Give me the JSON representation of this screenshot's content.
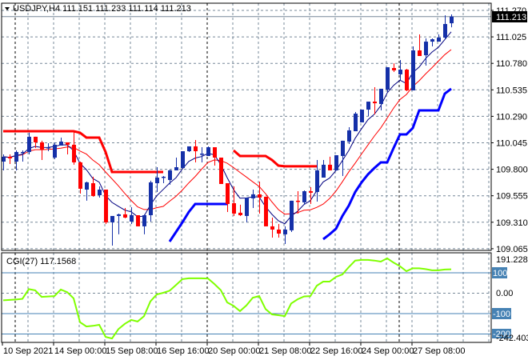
{
  "header": {
    "symbol": "USDJPY,H4",
    "ohlc": "111.151 111.233 111.114 111.213"
  },
  "colors": {
    "bull": "#1530a8",
    "bear": "#ff0000",
    "fast_ma": "#000080",
    "slow_ma": "#ff0000",
    "upper_band": "#ff0000",
    "lower_band": "#0000ff",
    "cci": "#7fff00",
    "level_line": "#4682b4",
    "grid": "#778899"
  },
  "price_axis": {
    "labels": [
      "111.270",
      "111.025",
      "110.780",
      "110.535",
      "110.290",
      "110.045",
      "109.800",
      "109.555",
      "109.310",
      "109.065"
    ],
    "current_price": "111.213"
  },
  "cci_panel": {
    "label": "CGI(27) 117.1568",
    "max_label": "191.2285",
    "min_label": "-242.4031",
    "zero_label": "0.00",
    "levels": [
      "100",
      "-100",
      "-200"
    ]
  },
  "time_axis": {
    "labels": [
      "10 Sep 2021",
      "14 Sep 00:00",
      "15 Sep 08:00",
      "16 Sep 16:00",
      "20 Sep 00:00",
      "21 Sep 08:00",
      "22 Sep 16:00",
      "24 Sep 00:00",
      "27 Sep 08:00"
    ]
  },
  "chart_data": {
    "type": "candlestick",
    "symbol": "USDJPY",
    "timeframe": "H4",
    "ylim": [
      109.065,
      111.27
    ],
    "candles": [
      [
        109.871,
        109.938,
        109.79,
        109.916
      ],
      [
        109.916,
        109.938,
        109.849,
        109.901
      ],
      [
        109.871,
        109.975,
        109.79,
        109.96
      ],
      [
        109.953,
        109.975,
        109.871,
        109.96
      ],
      [
        109.96,
        110.138,
        109.938,
        110.101
      ],
      [
        110.101,
        110.101,
        109.997,
        110.049
      ],
      [
        110.049,
        110.064,
        109.886,
        109.982
      ],
      [
        109.997,
        110.041,
        109.967,
        110.004
      ],
      [
        109.908,
        110.049,
        109.893,
        110.027
      ],
      [
        110.019,
        110.093,
        110.019,
        110.056
      ],
      [
        110.049,
        110.049,
        109.938,
        110.027
      ],
      [
        110.027,
        110.145,
        109.842,
        109.864
      ],
      [
        109.864,
        109.871,
        109.575,
        109.62
      ],
      [
        109.612,
        109.686,
        109.509,
        109.679
      ],
      [
        109.671,
        109.731,
        109.546,
        109.553
      ],
      [
        109.56,
        109.642,
        109.538,
        109.612
      ],
      [
        109.612,
        109.612,
        109.294,
        109.309
      ],
      [
        109.309,
        109.368,
        109.094,
        109.368
      ],
      [
        109.368,
        109.39,
        109.198,
        109.383
      ],
      [
        109.383,
        109.442,
        109.346,
        109.353
      ],
      [
        109.316,
        109.449,
        109.294,
        109.375
      ],
      [
        109.375,
        109.375,
        109.272,
        109.272
      ],
      [
        109.272,
        109.383,
        109.198,
        109.375
      ],
      [
        109.375,
        109.694,
        109.316,
        109.679
      ],
      [
        109.671,
        109.819,
        109.59,
        109.723
      ],
      [
        109.723,
        109.738,
        109.671,
        109.731
      ],
      [
        109.701,
        109.797,
        109.657,
        109.79
      ],
      [
        109.79,
        109.908,
        109.79,
        109.819
      ],
      [
        109.812,
        109.967,
        109.812,
        109.967
      ],
      [
        109.967,
        110.012,
        109.96,
        110.012
      ],
      [
        110.012,
        110.071,
        109.864,
        109.967
      ],
      [
        109.938,
        110.004,
        109.864,
        109.945
      ],
      [
        109.923,
        110.012,
        109.923,
        110.004
      ],
      [
        110.004,
        110.004,
        109.834,
        109.908
      ],
      [
        109.908,
        109.908,
        109.664,
        109.664
      ],
      [
        109.671,
        109.671,
        109.405,
        109.479
      ],
      [
        109.486,
        109.642,
        109.368,
        109.39
      ],
      [
        109.398,
        109.472,
        109.368,
        109.375
      ],
      [
        109.368,
        109.538,
        109.309,
        109.538
      ],
      [
        109.531,
        109.612,
        109.442,
        109.568
      ],
      [
        109.568,
        109.686,
        109.39,
        109.538
      ],
      [
        109.546,
        109.546,
        109.272,
        109.272
      ],
      [
        109.272,
        109.353,
        109.168,
        109.242
      ],
      [
        109.242,
        109.294,
        109.168,
        109.205
      ],
      [
        109.198,
        109.272,
        109.109,
        109.242
      ],
      [
        109.235,
        109.509,
        109.22,
        109.509
      ],
      [
        109.509,
        109.597,
        109.39,
        109.501
      ],
      [
        109.494,
        109.605,
        109.472,
        109.597
      ],
      [
        109.597,
        109.634,
        109.479,
        109.583
      ],
      [
        109.59,
        109.886,
        109.501,
        109.79
      ],
      [
        109.723,
        109.886,
        109.723,
        109.842
      ],
      [
        109.842,
        109.916,
        109.79,
        109.79
      ],
      [
        109.79,
        109.93,
        109.79,
        109.93
      ],
      [
        109.923,
        110.064,
        109.738,
        110.064
      ],
      [
        110.056,
        110.189,
        110.034,
        110.16
      ],
      [
        110.152,
        110.33,
        110.152,
        110.315
      ],
      [
        110.234,
        110.352,
        110.234,
        110.352
      ],
      [
        110.352,
        110.426,
        110.293,
        110.426
      ],
      [
        110.426,
        110.559,
        110.308,
        110.411
      ],
      [
        110.404,
        110.545,
        110.345,
        110.545
      ],
      [
        110.537,
        110.744,
        110.515,
        110.744
      ],
      [
        110.737,
        110.781,
        110.7,
        110.715
      ],
      [
        110.678,
        110.811,
        110.626,
        110.722
      ],
      [
        110.722,
        110.73,
        110.522,
        110.53
      ],
      [
        110.53,
        110.937,
        110.53,
        110.9
      ],
      [
        110.9,
        111.048,
        110.848,
        110.848
      ],
      [
        110.855,
        111.011,
        110.759,
        110.981
      ],
      [
        110.981,
        111.011,
        110.937,
        111.003
      ],
      [
        110.981,
        111.048,
        110.981,
        111.018
      ],
      [
        111.018,
        111.225,
        111.003,
        111.144
      ],
      [
        111.151,
        111.233,
        111.114,
        111.213
      ]
    ],
    "fast_ma": {
      "type": "EMA",
      "period": 5
    },
    "slow_ma": {
      "type": "SMA",
      "period": 10
    },
    "upper_band": [
      110.152,
      110.152,
      110.152,
      110.152,
      110.152,
      110.152,
      110.152,
      110.152,
      110.152,
      110.152,
      110.152,
      110.152,
      110.138,
      110.093,
      110.093,
      110.093,
      109.96,
      109.775,
      109.775,
      109.775,
      109.775,
      109.775,
      109.775,
      109.775,
      109.775,
      109.775,
      null,
      null,
      null,
      null,
      null,
      null,
      null,
      null,
      null,
      null,
      109.975,
      109.923,
      109.923,
      109.923,
      109.923,
      109.923,
      109.886,
      109.834,
      109.827,
      109.827,
      109.827,
      109.827,
      109.827,
      109.827,
      null,
      null,
      null,
      null,
      null,
      null,
      null,
      null,
      null,
      null,
      null,
      null,
      null,
      null,
      null,
      null,
      null,
      null,
      null,
      null,
      null
    ],
    "lower_band": [
      null,
      null,
      null,
      null,
      null,
      null,
      null,
      null,
      null,
      null,
      null,
      null,
      null,
      null,
      null,
      null,
      null,
      null,
      null,
      null,
      null,
      null,
      null,
      null,
      null,
      null,
      109.131,
      109.22,
      109.309,
      109.405,
      109.479,
      109.479,
      109.479,
      109.479,
      109.479,
      109.479,
      null,
      null,
      null,
      null,
      null,
      null,
      null,
      null,
      null,
      null,
      null,
      null,
      null,
      null,
      109.153,
      109.198,
      109.25,
      109.368,
      109.464,
      109.59,
      109.679,
      109.753,
      109.812,
      109.864,
      109.864,
      109.997,
      110.123,
      110.123,
      110.182,
      110.345,
      110.345,
      110.345,
      110.345,
      110.5,
      110.545
    ],
    "cci": {
      "period": 27,
      "ylim": [
        -242.4031,
        191.2285
      ],
      "levels": [
        100,
        0,
        -100,
        -200
      ],
      "values": [
        -35,
        -33,
        -31,
        -28,
        20,
        14,
        -18,
        -16,
        -14,
        18,
        5,
        -25,
        -142,
        -163,
        -160,
        -155,
        -214,
        -222,
        -176,
        -150,
        -131,
        -139,
        -113,
        -40,
        -6,
        2,
        12,
        40,
        69,
        73,
        73,
        73,
        72,
        45,
        15,
        -45,
        -62,
        -88,
        -60,
        -22,
        -14,
        -78,
        -104,
        -108,
        -112,
        -50,
        -30,
        -16,
        -14,
        37,
        57,
        57,
        80,
        92,
        128,
        160,
        163,
        163,
        160,
        155,
        171,
        150,
        132,
        108,
        122,
        122,
        118,
        112,
        112,
        116,
        117.1568
      ]
    }
  }
}
